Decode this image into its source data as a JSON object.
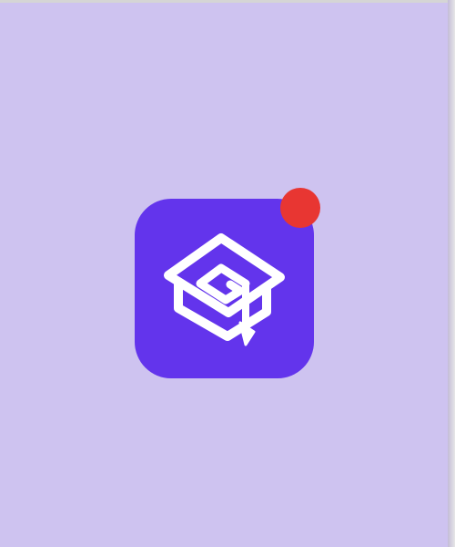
{
  "app": {
    "icon": "graduation-cap-icon",
    "icon_bg_color": "#6334ec",
    "glyph_color": "#ffffff",
    "has_notification": true,
    "badge_color": "#e83632"
  },
  "background_color": "#cec3f0"
}
